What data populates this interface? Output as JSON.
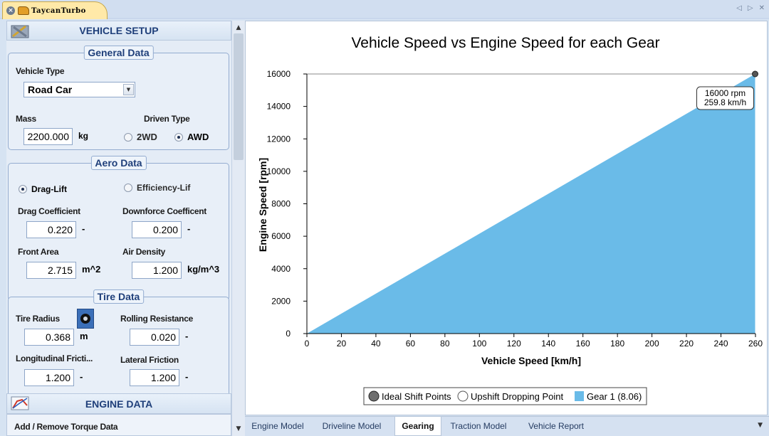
{
  "document_tab": {
    "title": "TaycanTurbo"
  },
  "tab_controls": {
    "left": "◁",
    "right": "▷",
    "close": "✕"
  },
  "vehicle_setup": {
    "title": "VEHICLE SETUP",
    "general": {
      "title": "General Data",
      "vehicle_type_label": "Vehicle Type",
      "vehicle_type_value": "Road Car",
      "mass_label": "Mass",
      "mass_value": "2200.000",
      "mass_unit": "kg",
      "driven_type_label": "Driven Type",
      "option_2wd": "2WD",
      "option_awd": "AWD",
      "selected": "AWD"
    },
    "aero": {
      "title": "Aero Data",
      "option_drag_lift": "Drag-Lift",
      "option_efficiency": "Efficiency-Lif",
      "selected": "Drag-Lift",
      "drag_coefficient_label": "Drag Coefficient",
      "drag_coefficient_value": "0.220",
      "drag_coefficient_unit": "-",
      "downforce_label": "Downforce Coefficent",
      "downforce_value": "0.200",
      "downforce_unit": "-",
      "front_area_label": "Front Area",
      "front_area_value": "2.715",
      "front_area_unit": "m^2",
      "air_density_label": "Air Density",
      "air_density_value": "1.200",
      "air_density_unit": "kg/m^3"
    },
    "tire": {
      "title": "Tire Data",
      "tire_radius_label": "Tire Radius",
      "tire_radius_value": "0.368",
      "tire_radius_unit": "m",
      "rolling_resistance_label": "Rolling Resistance",
      "rolling_resistance_value": "0.020",
      "rolling_resistance_unit": "-",
      "longitudinal_label": "Longitudinal Fricti...",
      "longitudinal_value": "1.200",
      "longitudinal_unit": "-",
      "lateral_label": "Lateral Friction",
      "lateral_value": "1.200",
      "lateral_unit": "-"
    }
  },
  "engine_data": {
    "title": "ENGINE DATA",
    "add_remove_label": "Add / Remove Torque Data"
  },
  "bottom_tabs": [
    {
      "label": "Engine Model",
      "active": false
    },
    {
      "label": "Driveline Model",
      "active": false
    },
    {
      "label": "Gearing",
      "active": true
    },
    {
      "label": "Traction Model",
      "active": false
    },
    {
      "label": "Vehicle Report",
      "active": false
    }
  ],
  "scroll": {
    "up": "▲",
    "down": "▼"
  },
  "colors": {
    "series_fill": "#6abbe8",
    "accent_title": "#1f3f7a"
  },
  "chart_data": {
    "type": "area",
    "title": "Vehicle Speed vs Engine Speed for each Gear",
    "xlabel": "Vehicle Speed [km/h]",
    "ylabel": "Engine Speed [rpm]",
    "xlim": [
      0,
      260
    ],
    "ylim": [
      0,
      16000
    ],
    "x_ticks": [
      0,
      20,
      40,
      60,
      80,
      100,
      120,
      140,
      160,
      180,
      200,
      220,
      240,
      260
    ],
    "y_ticks": [
      0,
      2000,
      4000,
      6000,
      8000,
      10000,
      12000,
      14000,
      16000
    ],
    "series": [
      {
        "name": "Gear 1 (8.06)",
        "x": [
          0,
          259.8
        ],
        "y": [
          0,
          16000
        ]
      }
    ],
    "annotations": [
      {
        "x": 259.8,
        "y": 16000,
        "text": [
          "16000 rpm",
          "259.8 km/h"
        ]
      }
    ],
    "legend": {
      "placement": "bottom-center",
      "entries": [
        "Ideal Shift Points",
        "Upshift Dropping Point",
        "Gear 1 (8.06)"
      ]
    },
    "grid": false
  }
}
